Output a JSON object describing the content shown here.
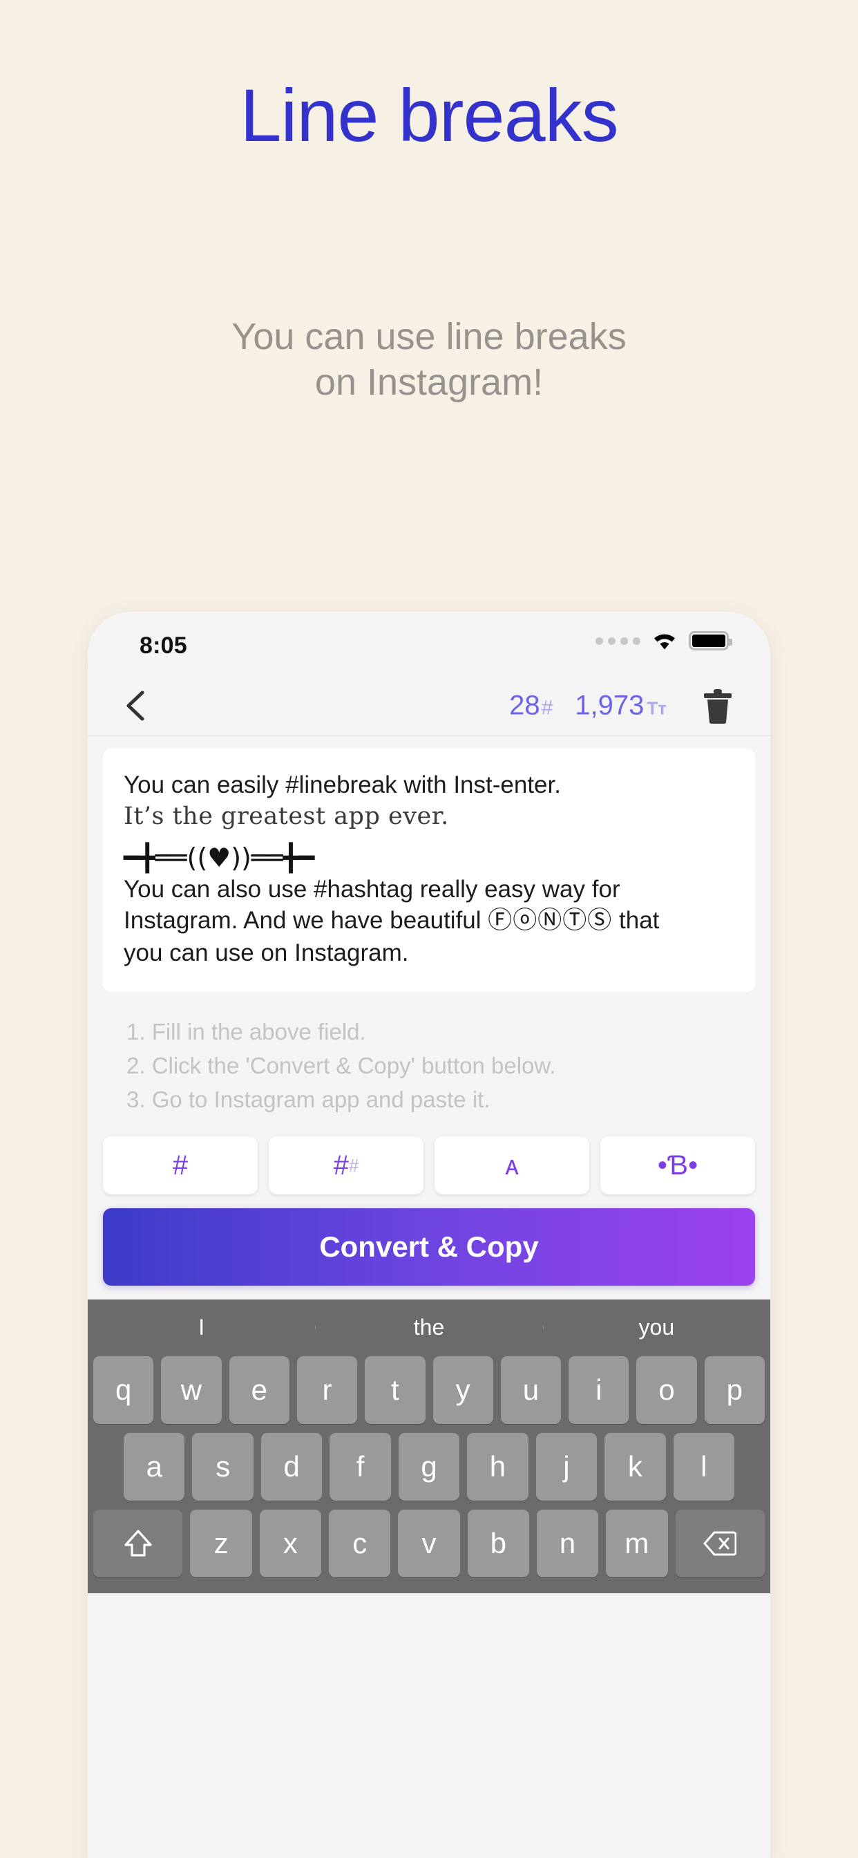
{
  "promo": {
    "headline": "Line breaks",
    "subtitle_line1": "You can use line breaks",
    "subtitle_line2": "on Instagram!",
    "headline_color": "#3333CC",
    "subtitle_color": "#96938E",
    "background_color": "#F7F0E5"
  },
  "phone": {
    "status_bar": {
      "time": "8:05",
      "signal_icon": "signal-dots-icon",
      "wifi_icon": "wifi-icon",
      "battery_icon": "battery-full-icon"
    },
    "nav_bar": {
      "back_icon": "chevron-left-icon",
      "hashtag_count": "28",
      "hashtag_suffix": "#",
      "character_count": "1,973",
      "character_suffix": "Tт",
      "delete_icon": "trash-icon",
      "counter_color": "#6C63E8"
    },
    "editor": {
      "lines": [
        {
          "text": "You can easily #linebreak with Inst-enter.",
          "style": "plain"
        },
        {
          "text": "It’s the greatest app ever.",
          "style": "fancy-outline"
        },
        {
          "text": "",
          "style": "blank"
        },
        {
          "text": "━╋══((♥))══╋━",
          "style": "decoration"
        },
        {
          "text": "You can also use #hashtag really easy way for",
          "style": "plain"
        },
        {
          "text": "Instagram. And we have beautiful ",
          "style": "plain",
          "bubble": "ⒻⓞⓃⓉⓈ",
          "after": " that"
        },
        {
          "text": "you can use on Instagram.",
          "style": "plain"
        }
      ]
    },
    "instructions": [
      "1. Fill in the above field.",
      "2. Click the 'Convert & Copy' button below.",
      "3. Go to Instagram app and paste it."
    ],
    "tools": [
      {
        "name": "hashtag-button",
        "glyph": "#",
        "sub": ""
      },
      {
        "name": "hashtag-small-button",
        "glyph": "#",
        "sub": "#"
      },
      {
        "name": "fancy-font-button",
        "glyph": "ᴀ",
        "sub": ""
      },
      {
        "name": "decoration-button",
        "glyph": "•Ɓ•",
        "sub": ""
      }
    ],
    "convert_button": {
      "label": "Convert & Copy",
      "gradient_start": "#3D3BC9",
      "gradient_end": "#9C42EE"
    },
    "keyboard": {
      "predictions": [
        "I",
        "the",
        "you"
      ],
      "row_top": [
        "q",
        "w",
        "e",
        "r",
        "t",
        "y",
        "u",
        "i",
        "o",
        "p"
      ],
      "row_mid": [
        "a",
        "s",
        "d",
        "f",
        "g",
        "h",
        "j",
        "k",
        "l"
      ],
      "row_bottom_letters": [
        "z",
        "x",
        "c",
        "v",
        "b",
        "n",
        "m"
      ],
      "shift_icon": "shift-arrow-icon",
      "backspace_icon": "backspace-icon",
      "background_color": "#6B6B6B",
      "key_color": "#9A9A9A"
    }
  }
}
